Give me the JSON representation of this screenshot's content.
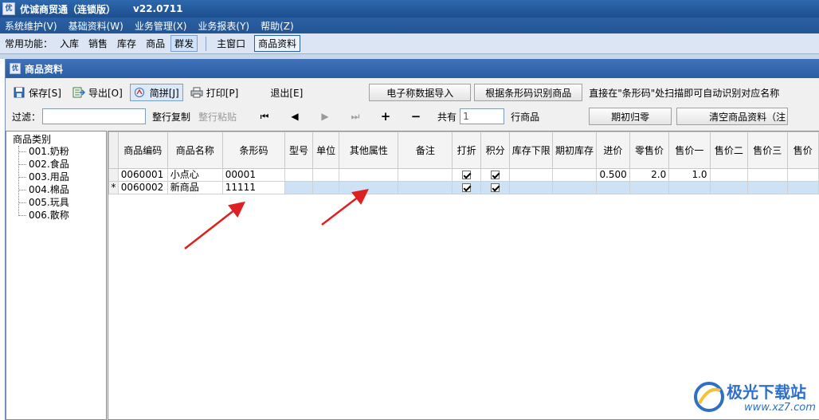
{
  "app": {
    "icon_text": "优",
    "title": "优诚商贸通（连锁版）",
    "version": "v22.0711"
  },
  "menu": [
    "系统维护(V)",
    "基础资料(W)",
    "业务管理(X)",
    "业务报表(Y)",
    "帮助(Z)"
  ],
  "quickbar": {
    "label": "常用功能：",
    "buttons": [
      "入库",
      "销售",
      "库存",
      "商品",
      "群发"
    ],
    "active_button": "群发",
    "windows": [
      "主窗口",
      "商品资料"
    ],
    "active_window": "商品资料"
  },
  "window": {
    "title": "商品资料"
  },
  "toolbar": {
    "save": "保存[S]",
    "export": "导出[O]",
    "pinyin": "简拼[J]",
    "print": "打印[P]",
    "exit": "退出[E]",
    "scale_import": "电子称数据导入",
    "barcode_identify": "根据条形码识别商品",
    "hint": "直接在\"条形码\"处扫描即可自动识别对应名称"
  },
  "filterbar": {
    "filter_label": "过滤：",
    "filter_value": "",
    "copy_row": "整行复制",
    "paste_row": "整行粘贴",
    "nav_first": "⏮",
    "nav_prev": "◀",
    "nav_next": "▶",
    "nav_last": "⏭",
    "nav_add": "+",
    "nav_remove": "−",
    "count_prefix": "共有",
    "count_value": "1",
    "count_suffix": "行商品",
    "reset_initial": "期初归零",
    "clear_goods": "清空商品资料（注"
  },
  "tree": {
    "root": "商品类别",
    "nodes": [
      "001.奶粉",
      "002.食品",
      "003.用品",
      "004.棉品",
      "005.玩具",
      "006.散称"
    ]
  },
  "grid": {
    "columns": [
      "商品编码",
      "商品名称",
      "条形码",
      "型号",
      "单位",
      "其他属性",
      "备注",
      "打折",
      "积分",
      "库存下限",
      "期初库存",
      "进价",
      "零售价",
      "售价一",
      "售价二",
      "售价三",
      "售价"
    ],
    "rows": [
      {
        "indicator": "",
        "code": "0060001",
        "name": "小点心",
        "barcode": "00001",
        "model": "",
        "unit": "",
        "attrs": "",
        "note": "",
        "discount": true,
        "points": true,
        "stock_min": "",
        "stock_init": "",
        "cost": "0.500",
        "retail": "2.0",
        "price1": "1.0",
        "price2": "",
        "price3": "",
        "price4": ""
      },
      {
        "indicator": "*",
        "code": "0060002",
        "name": "新商品",
        "barcode": "11111",
        "model": "",
        "unit": "",
        "attrs": "",
        "note": "",
        "discount": true,
        "points": true,
        "stock_min": "",
        "stock_init": "",
        "cost": "",
        "retail": "",
        "price1": "",
        "price2": "",
        "price3": "",
        "price4": ""
      }
    ]
  },
  "watermark": {
    "text": "极光下载站",
    "url": "www.xz7.com"
  },
  "colors": {
    "titlebar": "#1d4f8f",
    "accent": "#2a5fa3",
    "selection": "#cde2f5",
    "annotation_arrow": "#e02020"
  }
}
